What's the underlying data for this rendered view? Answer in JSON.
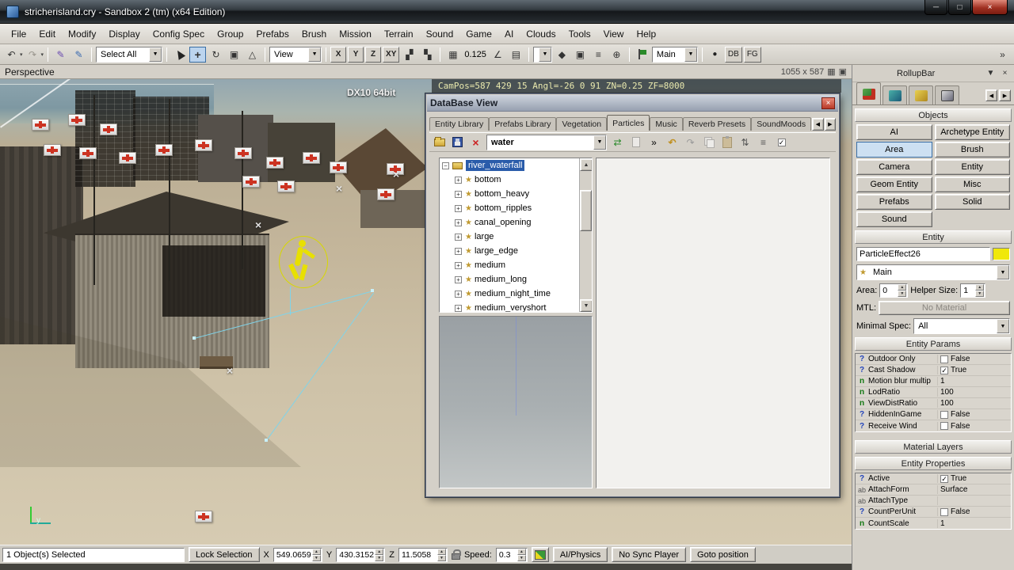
{
  "titlebar": {
    "title": "stricherisland.cry - Sandbox 2 (tm) (x64 Edition)"
  },
  "menubar": {
    "items": [
      "File",
      "Edit",
      "Modify",
      "Display",
      "Config Spec",
      "Group",
      "Prefabs",
      "Brush",
      "Mission",
      "Terrain",
      "Sound",
      "Game",
      "AI",
      "Clouds",
      "Tools",
      "View",
      "Help"
    ]
  },
  "toolbar": {
    "select_combo": "Select All",
    "view_combo": "View",
    "axis": [
      "X",
      "Y",
      "Z",
      "XY"
    ],
    "snap_value": "0.125",
    "main_combo": "Main",
    "db": "DB",
    "fg": "FG"
  },
  "viewport": {
    "label": "Perspective",
    "resolution": "1055 x 587",
    "cam_overlay": "CamPos=587 429  15  Angl=-26  0  91  ZN=0.25 ZF=8000",
    "dx_label": "DX10 64bit",
    "axis_y_label": "y"
  },
  "database": {
    "title": "DataBase View",
    "tabs": [
      "Entity Library",
      "Prefabs Library",
      "Vegetation",
      "Particles",
      "Music",
      "Reverb Presets",
      "SoundMoods"
    ],
    "active_tab": "Particles",
    "library_combo": "water",
    "tree_root": "river_waterfall",
    "tree_items": [
      "bottom",
      "bottom_heavy",
      "bottom_ripples",
      "canal_opening",
      "large",
      "large_edge",
      "medium",
      "medium_long",
      "medium_night_time",
      "medium_veryshort"
    ]
  },
  "rollupbar": {
    "title": "RollupBar",
    "sections": {
      "objects": "Objects",
      "entity": "Entity",
      "entity_params": "Entity Params",
      "material_layers": "Material Layers",
      "entity_properties": "Entity Properties"
    },
    "object_buttons": [
      "AI",
      "Archetype Entity",
      "Area",
      "Brush",
      "Camera",
      "Entity",
      "Geom Entity",
      "Misc",
      "Prefabs",
      "Solid",
      "Sound"
    ],
    "active_object_button": "Area",
    "entity": {
      "name": "ParticleEffect26",
      "effect_combo": "Main",
      "area_label": "Area:",
      "area_value": "0",
      "helper_label": "Helper Size:",
      "helper_value": "1",
      "mtl_label": "MTL:",
      "mtl_value": "No Material",
      "minspec_label": "Minimal Spec:",
      "minspec_value": "All"
    },
    "entity_params": [
      {
        "type": "?",
        "name": "Outdoor Only",
        "value": "False",
        "checked": false
      },
      {
        "type": "?",
        "name": "Cast Shadow",
        "value": "True",
        "checked": true
      },
      {
        "type": "n",
        "name": "Motion blur multip",
        "value": "1"
      },
      {
        "type": "n",
        "name": "LodRatio",
        "value": "100"
      },
      {
        "type": "n",
        "name": "ViewDistRatio",
        "value": "100"
      },
      {
        "type": "?",
        "name": "HiddenInGame",
        "value": "False",
        "checked": false
      },
      {
        "type": "?",
        "name": "Receive Wind",
        "value": "False",
        "checked": false
      }
    ],
    "entity_properties": [
      {
        "type": "?",
        "name": "Active",
        "value": "True",
        "checked": true
      },
      {
        "type": "ab",
        "name": "AttachForm",
        "value": "Surface"
      },
      {
        "type": "ab",
        "name": "AttachType",
        "value": ""
      },
      {
        "type": "?",
        "name": "CountPerUnit",
        "value": "False",
        "checked": false
      },
      {
        "type": "n",
        "name": "CountScale",
        "value": "1"
      }
    ]
  },
  "statusbar": {
    "selection": "1 Object(s) Selected",
    "lock_selection": "Lock Selection",
    "x_label": "X",
    "x": "549.0659",
    "y_label": "Y",
    "y": "430.3152",
    "z_label": "Z",
    "z": "11.5058",
    "speed_label": "Speed:",
    "speed": "0.3",
    "ai_physics": "AI/Physics",
    "no_sync": "No Sync Player",
    "goto": "Goto position"
  },
  "colors": {
    "selection_blue": "#2a5caa",
    "entity_swatch": "#f0e80a",
    "close_red": "#b93a28",
    "active_button_blue": "#cde0f2"
  }
}
